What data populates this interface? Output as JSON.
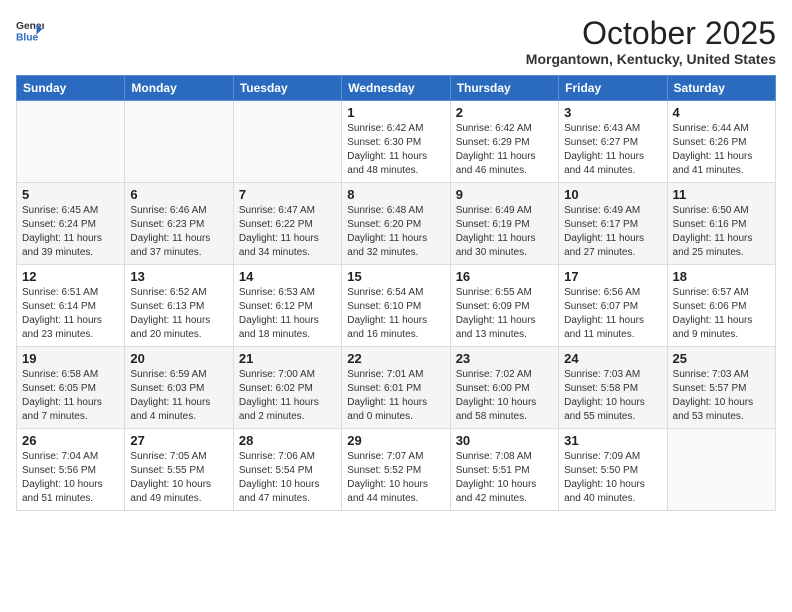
{
  "header": {
    "logo_general": "General",
    "logo_blue": "Blue",
    "month": "October 2025",
    "location": "Morgantown, Kentucky, United States"
  },
  "weekdays": [
    "Sunday",
    "Monday",
    "Tuesday",
    "Wednesday",
    "Thursday",
    "Friday",
    "Saturday"
  ],
  "weeks": [
    [
      {
        "day": "",
        "info": ""
      },
      {
        "day": "",
        "info": ""
      },
      {
        "day": "",
        "info": ""
      },
      {
        "day": "1",
        "info": "Sunrise: 6:42 AM\nSunset: 6:30 PM\nDaylight: 11 hours\nand 48 minutes."
      },
      {
        "day": "2",
        "info": "Sunrise: 6:42 AM\nSunset: 6:29 PM\nDaylight: 11 hours\nand 46 minutes."
      },
      {
        "day": "3",
        "info": "Sunrise: 6:43 AM\nSunset: 6:27 PM\nDaylight: 11 hours\nand 44 minutes."
      },
      {
        "day": "4",
        "info": "Sunrise: 6:44 AM\nSunset: 6:26 PM\nDaylight: 11 hours\nand 41 minutes."
      }
    ],
    [
      {
        "day": "5",
        "info": "Sunrise: 6:45 AM\nSunset: 6:24 PM\nDaylight: 11 hours\nand 39 minutes."
      },
      {
        "day": "6",
        "info": "Sunrise: 6:46 AM\nSunset: 6:23 PM\nDaylight: 11 hours\nand 37 minutes."
      },
      {
        "day": "7",
        "info": "Sunrise: 6:47 AM\nSunset: 6:22 PM\nDaylight: 11 hours\nand 34 minutes."
      },
      {
        "day": "8",
        "info": "Sunrise: 6:48 AM\nSunset: 6:20 PM\nDaylight: 11 hours\nand 32 minutes."
      },
      {
        "day": "9",
        "info": "Sunrise: 6:49 AM\nSunset: 6:19 PM\nDaylight: 11 hours\nand 30 minutes."
      },
      {
        "day": "10",
        "info": "Sunrise: 6:49 AM\nSunset: 6:17 PM\nDaylight: 11 hours\nand 27 minutes."
      },
      {
        "day": "11",
        "info": "Sunrise: 6:50 AM\nSunset: 6:16 PM\nDaylight: 11 hours\nand 25 minutes."
      }
    ],
    [
      {
        "day": "12",
        "info": "Sunrise: 6:51 AM\nSunset: 6:14 PM\nDaylight: 11 hours\nand 23 minutes."
      },
      {
        "day": "13",
        "info": "Sunrise: 6:52 AM\nSunset: 6:13 PM\nDaylight: 11 hours\nand 20 minutes."
      },
      {
        "day": "14",
        "info": "Sunrise: 6:53 AM\nSunset: 6:12 PM\nDaylight: 11 hours\nand 18 minutes."
      },
      {
        "day": "15",
        "info": "Sunrise: 6:54 AM\nSunset: 6:10 PM\nDaylight: 11 hours\nand 16 minutes."
      },
      {
        "day": "16",
        "info": "Sunrise: 6:55 AM\nSunset: 6:09 PM\nDaylight: 11 hours\nand 13 minutes."
      },
      {
        "day": "17",
        "info": "Sunrise: 6:56 AM\nSunset: 6:07 PM\nDaylight: 11 hours\nand 11 minutes."
      },
      {
        "day": "18",
        "info": "Sunrise: 6:57 AM\nSunset: 6:06 PM\nDaylight: 11 hours\nand 9 minutes."
      }
    ],
    [
      {
        "day": "19",
        "info": "Sunrise: 6:58 AM\nSunset: 6:05 PM\nDaylight: 11 hours\nand 7 minutes."
      },
      {
        "day": "20",
        "info": "Sunrise: 6:59 AM\nSunset: 6:03 PM\nDaylight: 11 hours\nand 4 minutes."
      },
      {
        "day": "21",
        "info": "Sunrise: 7:00 AM\nSunset: 6:02 PM\nDaylight: 11 hours\nand 2 minutes."
      },
      {
        "day": "22",
        "info": "Sunrise: 7:01 AM\nSunset: 6:01 PM\nDaylight: 11 hours\nand 0 minutes."
      },
      {
        "day": "23",
        "info": "Sunrise: 7:02 AM\nSunset: 6:00 PM\nDaylight: 10 hours\nand 58 minutes."
      },
      {
        "day": "24",
        "info": "Sunrise: 7:03 AM\nSunset: 5:58 PM\nDaylight: 10 hours\nand 55 minutes."
      },
      {
        "day": "25",
        "info": "Sunrise: 7:03 AM\nSunset: 5:57 PM\nDaylight: 10 hours\nand 53 minutes."
      }
    ],
    [
      {
        "day": "26",
        "info": "Sunrise: 7:04 AM\nSunset: 5:56 PM\nDaylight: 10 hours\nand 51 minutes."
      },
      {
        "day": "27",
        "info": "Sunrise: 7:05 AM\nSunset: 5:55 PM\nDaylight: 10 hours\nand 49 minutes."
      },
      {
        "day": "28",
        "info": "Sunrise: 7:06 AM\nSunset: 5:54 PM\nDaylight: 10 hours\nand 47 minutes."
      },
      {
        "day": "29",
        "info": "Sunrise: 7:07 AM\nSunset: 5:52 PM\nDaylight: 10 hours\nand 44 minutes."
      },
      {
        "day": "30",
        "info": "Sunrise: 7:08 AM\nSunset: 5:51 PM\nDaylight: 10 hours\nand 42 minutes."
      },
      {
        "day": "31",
        "info": "Sunrise: 7:09 AM\nSunset: 5:50 PM\nDaylight: 10 hours\nand 40 minutes."
      },
      {
        "day": "",
        "info": ""
      }
    ]
  ]
}
